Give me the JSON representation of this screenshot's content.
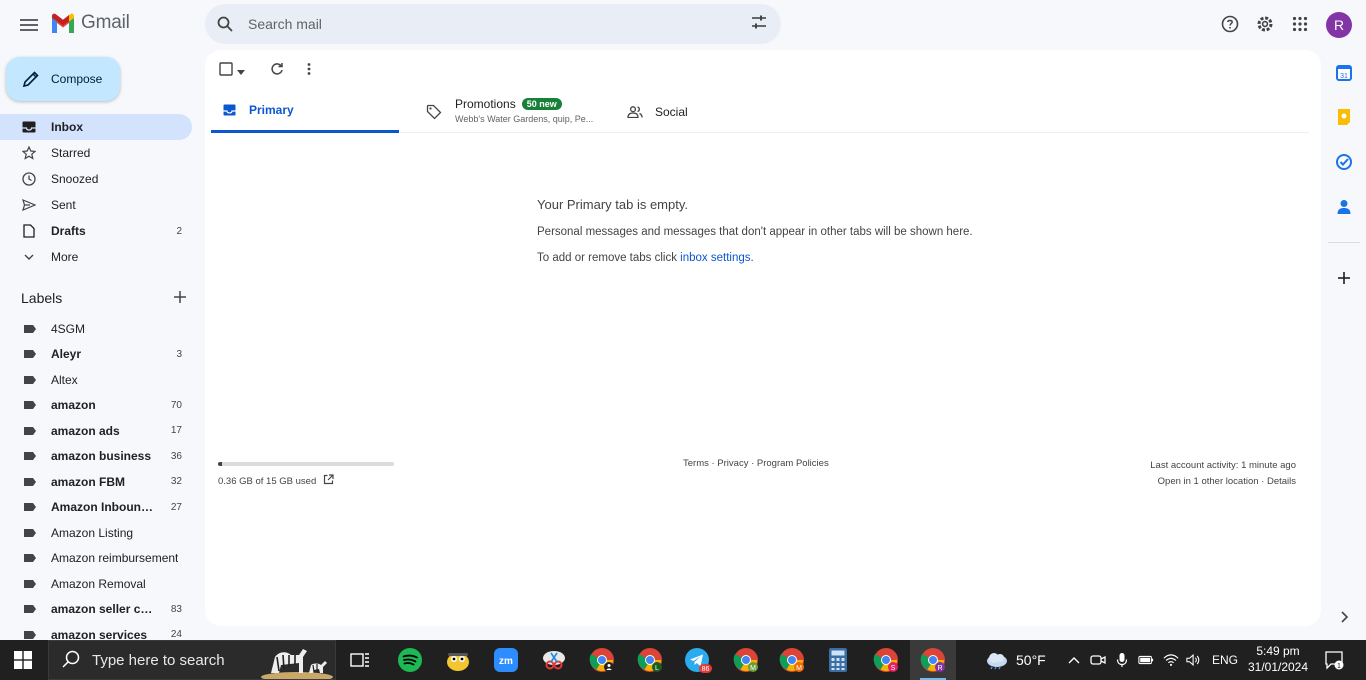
{
  "app": {
    "title": "Gmail"
  },
  "search": {
    "placeholder": "Search mail"
  },
  "account": {
    "initial": "R"
  },
  "compose": {
    "label": "Compose"
  },
  "nav": [
    {
      "label": "Inbox",
      "icon": "inbox-icon",
      "count": "",
      "active": true
    },
    {
      "label": "Starred",
      "icon": "star-icon",
      "count": ""
    },
    {
      "label": "Snoozed",
      "icon": "clock-icon",
      "count": ""
    },
    {
      "label": "Sent",
      "icon": "send-icon",
      "count": ""
    },
    {
      "label": "Drafts",
      "icon": "draft-icon",
      "count": "2"
    },
    {
      "label": "More",
      "icon": "chevron-down-icon",
      "count": ""
    }
  ],
  "labels_header": "Labels",
  "labels": [
    {
      "label": "4SGM",
      "count": ""
    },
    {
      "label": "Aleyr",
      "count": "3"
    },
    {
      "label": "Altex",
      "count": ""
    },
    {
      "label": "amazon",
      "count": "70"
    },
    {
      "label": "amazon ads",
      "count": "17"
    },
    {
      "label": "amazon business",
      "count": "36"
    },
    {
      "label": "amazon FBM",
      "count": "32"
    },
    {
      "label": "Amazon Inbound ...",
      "count": "27"
    },
    {
      "label": "Amazon Listing",
      "count": ""
    },
    {
      "label": "Amazon reimbursement",
      "count": ""
    },
    {
      "label": "Amazon Removal",
      "count": ""
    },
    {
      "label": "amazon seller cen...",
      "count": "83"
    },
    {
      "label": "amazon services",
      "count": "24"
    }
  ],
  "tabs": {
    "primary": "Primary",
    "promotions": "Promotions",
    "promotions_badge": "50 new",
    "promotions_sub": "Webb's Water Gardens, quip, Pe...",
    "social": "Social"
  },
  "empty_state": {
    "title": "Your Primary tab is empty.",
    "line1": "Personal messages and messages that don't appear in other tabs will be shown here.",
    "line2_prefix": "To add or remove tabs click ",
    "line2_link": "inbox settings",
    "line2_suffix": "."
  },
  "storage": {
    "text": "0.36 GB of 15 GB used",
    "fraction": 0.024
  },
  "footer": {
    "links": "Terms · Privacy · Program Policies",
    "activity": "Last account activity: 1 minute ago",
    "location": "Open in 1 other location · Details"
  },
  "taskbar": {
    "search_placeholder": "Type here to search",
    "weather": "50°F",
    "language": "ENG",
    "time": "5:49 pm",
    "date": "31/01/2024",
    "telegram_badge": "86",
    "notification_count": "1"
  },
  "colors": {
    "accent": "#0b57d0",
    "compose_bg": "#c2e7ff",
    "active_nav": "#d3e3fd",
    "badge_green": "#188038",
    "avatar": "#8334a5"
  }
}
